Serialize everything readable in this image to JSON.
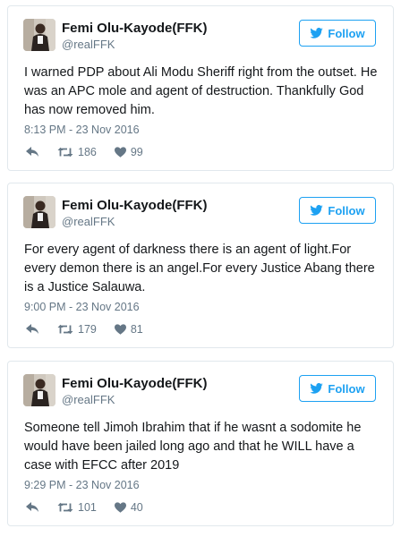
{
  "tweets": [
    {
      "name": "Femi Olu-Kayode(FFK)",
      "handle": "@realFFK",
      "follow_label": "Follow",
      "text": "I warned PDP about Ali Modu Sheriff right from the outset. He was an APC mole and agent of destruction. Thankfully God has now removed him.",
      "time": "8:13 PM - 23 Nov 2016",
      "retweets": "186",
      "likes": "99"
    },
    {
      "name": "Femi Olu-Kayode(FFK)",
      "handle": "@realFFK",
      "follow_label": "Follow",
      "text": "For every agent of darkness there is an agent of light.For every demon there is an angel.For every Justice Abang there is a Justice Salauwa.",
      "time": "9:00 PM - 23 Nov 2016",
      "retweets": "179",
      "likes": "81"
    },
    {
      "name": "Femi Olu-Kayode(FFK)",
      "handle": "@realFFK",
      "follow_label": "Follow",
      "text": "Someone tell Jimoh Ibrahim that if he wasnt a sodomite he would have been jailed long ago and that he WILL have a case with EFCC after 2019",
      "time": "9:29 PM - 23 Nov 2016",
      "retweets": "101",
      "likes": "40"
    }
  ],
  "colors": {
    "accent": "#1da1f2",
    "muted": "#657786",
    "text": "#14171a",
    "border": "#e1e8ed"
  },
  "icons": {
    "follow": "twitter-bird-icon",
    "reply": "reply-icon",
    "retweet": "retweet-icon",
    "like": "heart-icon",
    "avatar": "avatar-photo"
  }
}
